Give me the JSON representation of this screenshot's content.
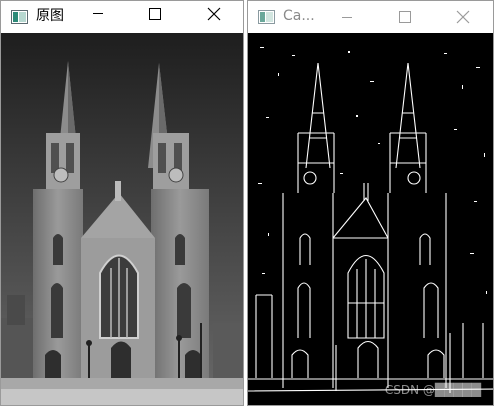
{
  "window_original": {
    "title": "原图",
    "icon": "opencv-window-icon",
    "buttons": [
      "minimize-icon",
      "maximize-icon",
      "close-icon"
    ]
  },
  "window_canny": {
    "title": "Ca...",
    "icon": "opencv-window-icon",
    "buttons": [
      "minimize-icon",
      "maximize-icon",
      "close-icon"
    ]
  },
  "watermark": "CSDN @█████",
  "colors": {
    "titlebar_active_text": "#000000",
    "titlebar_inactive_text": "#8a8a8a",
    "canny_background": "#000000",
    "canny_edges": "#ffffff"
  }
}
